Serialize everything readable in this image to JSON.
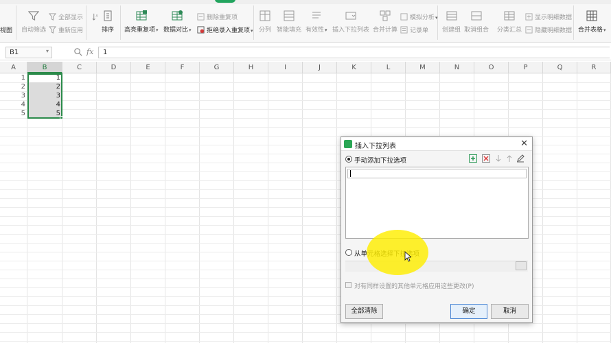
{
  "ribbon": {
    "col1": {
      "item1": "视图",
      "sub1": ""
    },
    "filter": {
      "auto_filter": "自动筛选",
      "show_all": "全部显示",
      "reapply": "重新应用"
    },
    "sort": {
      "sort": "排序"
    },
    "dup": {
      "highlight_dup": "高亮重复项",
      "compare": "数据对比",
      "remove_dup": "删除重复项",
      "reject_dup": "拒绝录入重复项"
    },
    "data": {
      "split": "分列",
      "smart_fill": "智能填充",
      "validity": "有效性",
      "insert_dropdown": "插入下拉列表",
      "merge_calc": "合并计算",
      "what_if": "模拟分析",
      "record": "记录单"
    },
    "group": {
      "create_group": "创建组",
      "ungroup": "取消组合",
      "subtotal": "分类汇总",
      "show_detail": "显示明细数据",
      "hide_detail": "隐藏明细数据"
    },
    "merge": {
      "merge_tables": "合并表格"
    }
  },
  "formula_bar": {
    "name_box": "B1",
    "fx": "fx",
    "value": "1"
  },
  "sheet": {
    "columns": [
      "A",
      "B",
      "C",
      "D",
      "E",
      "F",
      "G",
      "H",
      "I",
      "J",
      "K",
      "L",
      "M",
      "N",
      "O",
      "P",
      "Q",
      "R"
    ],
    "selected_column": "B",
    "rows": [
      "1",
      "2",
      "3",
      "4",
      "5"
    ],
    "values": [
      "1",
      "2",
      "3",
      "4",
      "5"
    ]
  },
  "dialog": {
    "title": "插入下拉列表",
    "close": "✕",
    "option_manual": "手动添加下拉选项",
    "option_from_cells": "从单元格选择下拉选项",
    "apply_same": "对有同样设置的其他单元格应用这些更改(P)",
    "clear_all": "全部清除",
    "ok": "确定",
    "cancel": "取消",
    "manual_selected": true
  }
}
